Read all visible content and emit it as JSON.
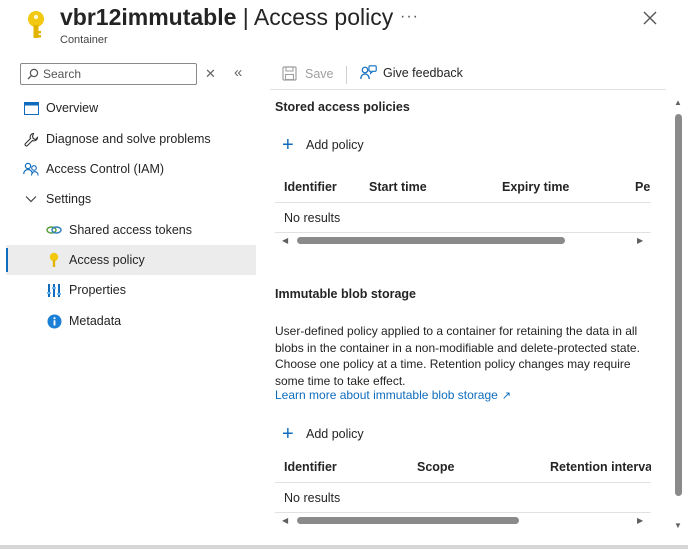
{
  "header": {
    "resource_name": "vbr12immutable",
    "separator": "|",
    "page_name": "Access policy",
    "subtitle": "Container",
    "more_label": "···"
  },
  "colors": {
    "accent": "#0f6cbd",
    "key_icon": "#f2c811",
    "active_bg": "#ececec",
    "border": "#e1e1e1"
  },
  "search": {
    "placeholder": "Search",
    "value": ""
  },
  "nav": {
    "items": [
      {
        "label": "Overview",
        "icon": "overview-icon"
      },
      {
        "label": "Diagnose and solve problems",
        "icon": "wrench-icon"
      },
      {
        "label": "Access Control (IAM)",
        "icon": "people-icon"
      },
      {
        "label": "Settings",
        "icon": "chevron-down-icon"
      },
      {
        "label": "Shared access tokens",
        "icon": "link-icon"
      },
      {
        "label": "Access policy",
        "icon": "key-icon",
        "active": true
      },
      {
        "label": "Properties",
        "icon": "properties-icon"
      },
      {
        "label": "Metadata",
        "icon": "info-icon"
      }
    ]
  },
  "toolbar": {
    "save_label": "Save",
    "feedback_label": "Give feedback"
  },
  "stored_policies": {
    "title": "Stored access policies",
    "add_label": "Add policy",
    "columns": [
      "Identifier",
      "Start time",
      "Expiry time",
      "Per"
    ],
    "empty_text": "No results"
  },
  "immutable": {
    "title": "Immutable blob storage",
    "description": "User-defined policy applied to a container for retaining the data in all blobs in the container in a non-modifiable and delete-protected state. Choose one policy at a time. Retention policy changes may require some time to take effect.",
    "learn_more": "Learn more about immutable blob storage",
    "add_label": "Add policy",
    "columns": [
      "Identifier",
      "Scope",
      "Retention interval"
    ],
    "empty_text": "No results"
  }
}
